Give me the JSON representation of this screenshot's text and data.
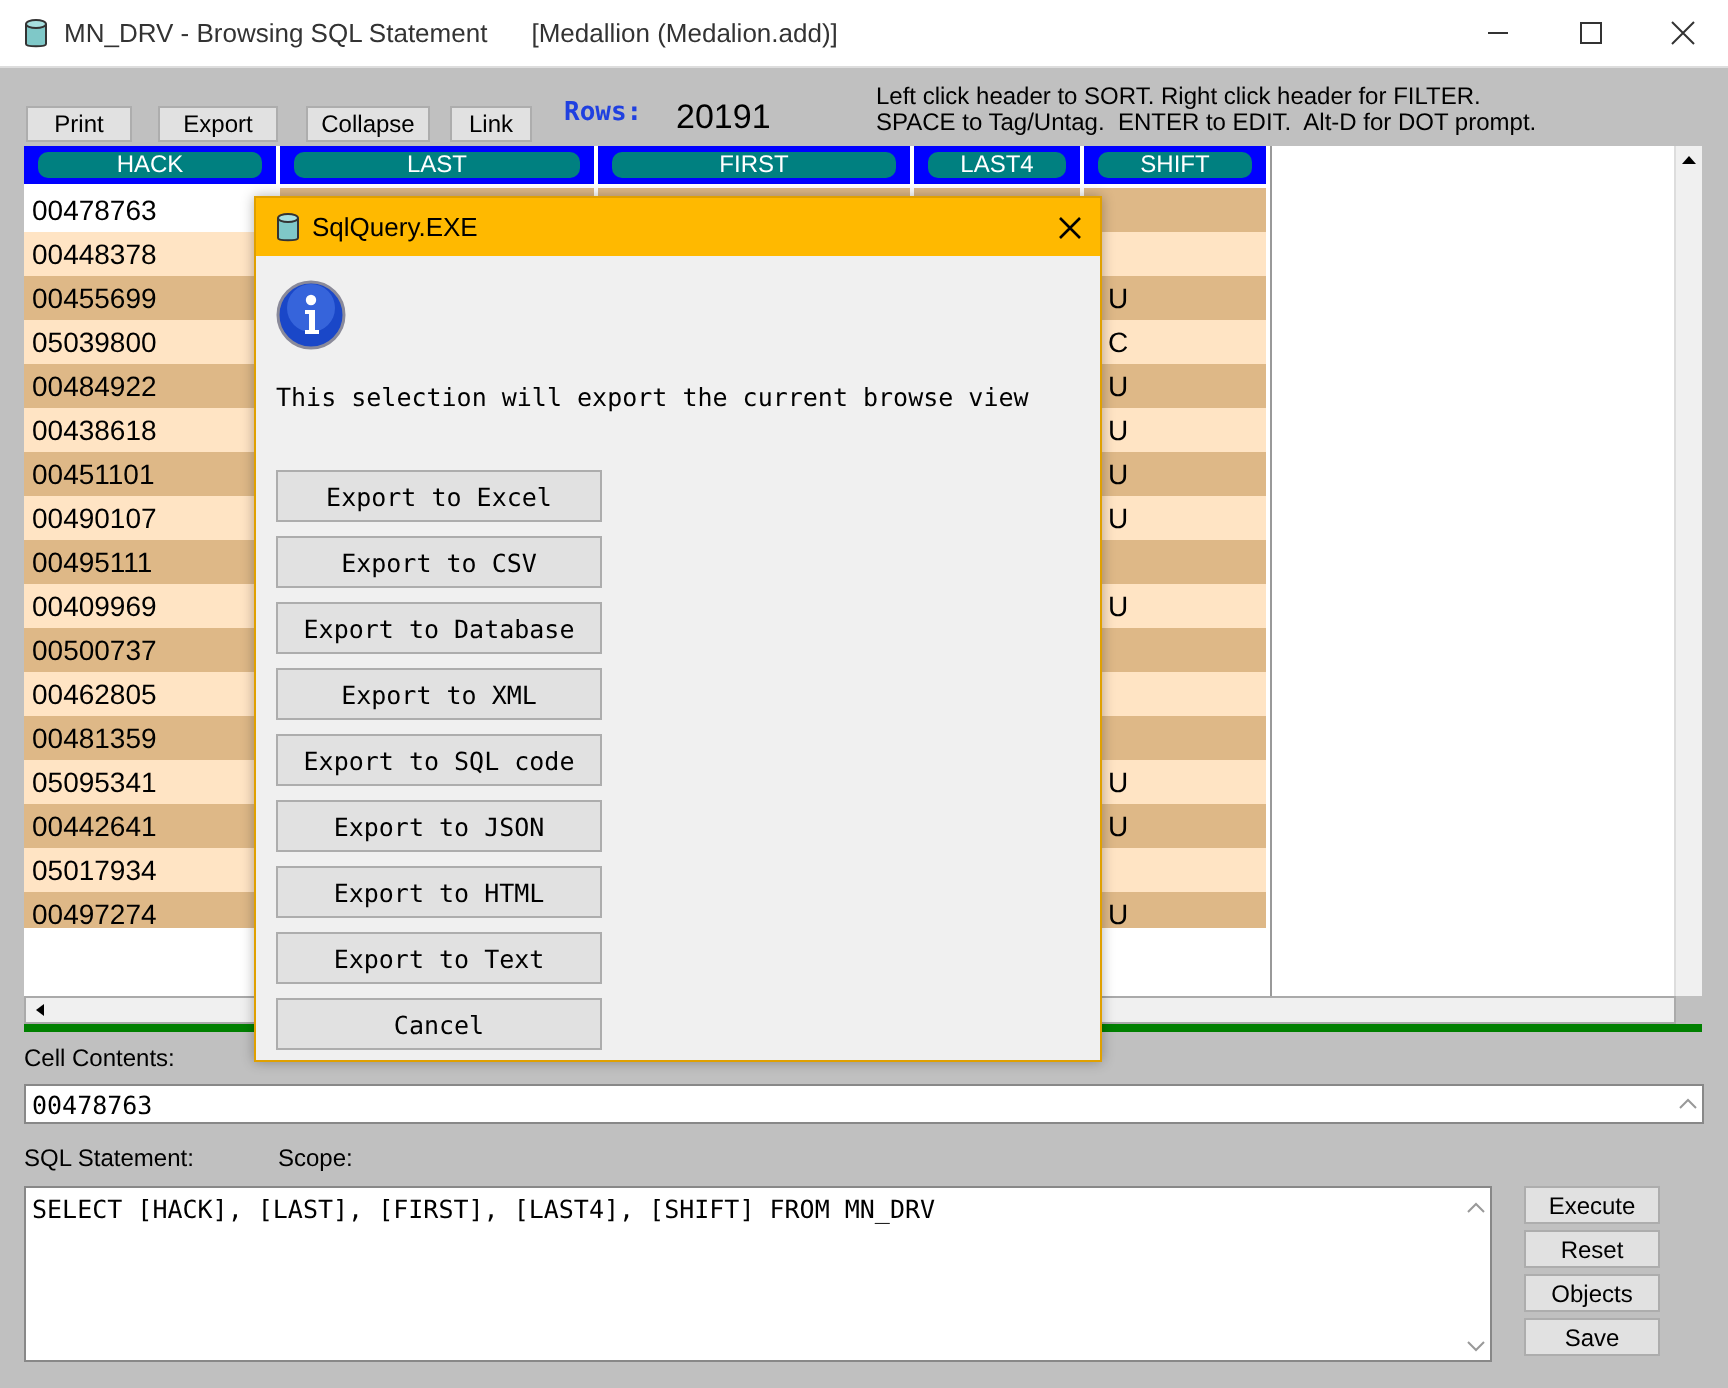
{
  "window": {
    "title": "MN_DRV - Browsing SQL Statement",
    "subtitle": "[Medallion (Medalion.add)]"
  },
  "toolbar": {
    "buttons": [
      "Print",
      "Export",
      "Collapse",
      "Link"
    ],
    "rows_label": "Rows:",
    "rows_count": "20191",
    "hints": [
      "Left click header to SORT. Right click header for FILTER.",
      "SPACE to Tag/Untag.  ENTER to EDIT.  Alt-D for DOT prompt."
    ]
  },
  "grid": {
    "columns": [
      "HACK",
      "LAST",
      "FIRST",
      "LAST4",
      "SHIFT"
    ],
    "rows": [
      {
        "hack": "00478763",
        "selected": true
      },
      {
        "hack": "00448378",
        "selected": false
      },
      {
        "hack": "00455699",
        "shift": "U",
        "selected": false
      },
      {
        "hack": "05039800",
        "shift": "C",
        "selected": false
      },
      {
        "hack": "00484922",
        "shift": "U",
        "selected": false
      },
      {
        "hack": "00438618",
        "shift": "U",
        "selected": false
      },
      {
        "hack": "00451101",
        "shift": "U",
        "selected": false
      },
      {
        "hack": "00490107",
        "shift": "U",
        "selected": false
      },
      {
        "hack": "00495111",
        "selected": false
      },
      {
        "hack": "00409969",
        "shift": "U",
        "selected": false
      },
      {
        "hack": "00500737",
        "selected": false
      },
      {
        "hack": "00462805",
        "selected": false
      },
      {
        "hack": "00481359",
        "selected": false
      },
      {
        "hack": "05095341",
        "shift": "U",
        "selected": false
      },
      {
        "hack": "00442641",
        "shift": "U",
        "selected": false
      },
      {
        "hack": "05017934",
        "selected": false
      },
      {
        "hack": "00497274",
        "shift": "U",
        "selected": false
      }
    ]
  },
  "dialog": {
    "title": "SqlQuery.EXE",
    "message": "This selection will export the current browse view",
    "buttons": [
      "Export to Excel",
      "Export to CSV",
      "Export to Database",
      "Export to XML",
      "Export to SQL code",
      "Export to JSON",
      "Export to HTML",
      "Export to Text",
      "Cancel"
    ]
  },
  "cell_contents": {
    "label": "Cell Contents:",
    "value": "00478763"
  },
  "sql": {
    "label": "SQL Statement:",
    "scope_label": "Scope:",
    "value": "SELECT [HACK], [LAST], [FIRST], [LAST4], [SHIFT] FROM MN_DRV",
    "buttons": [
      "Execute",
      "Reset",
      "Objects",
      "Save"
    ]
  }
}
